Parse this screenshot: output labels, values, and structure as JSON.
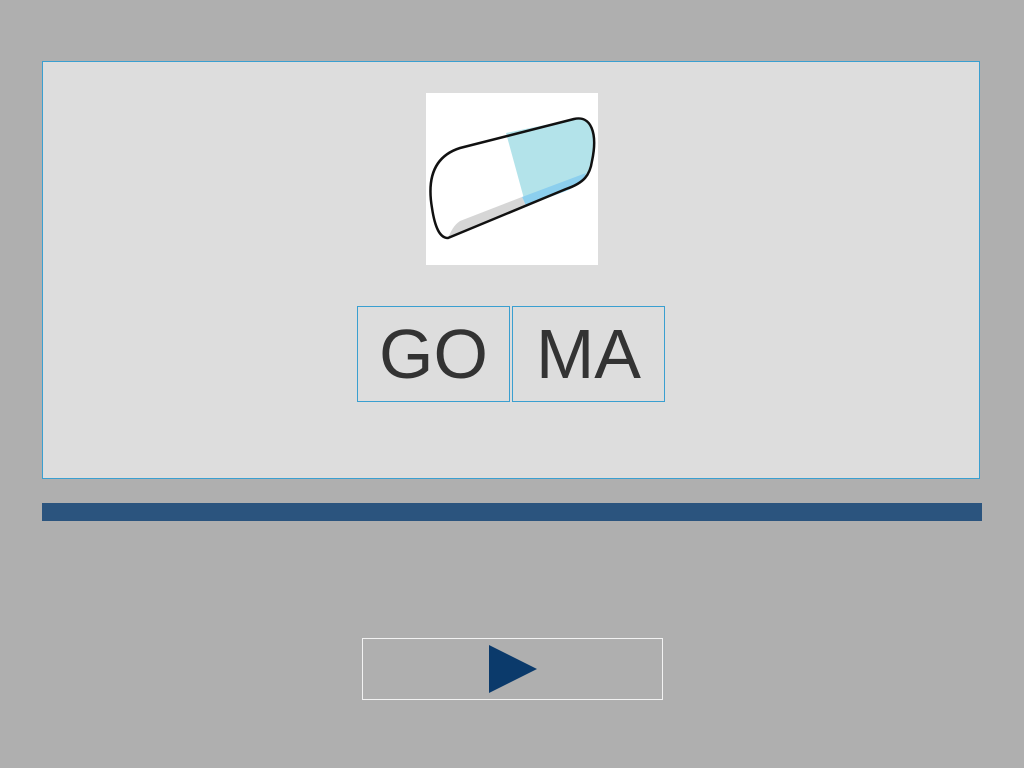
{
  "picture": {
    "icon": "eraser-icon"
  },
  "syllables": [
    {
      "text": "GO"
    },
    {
      "text": "MA"
    }
  ],
  "progress": {
    "fraction": 1.0
  },
  "next_button": {
    "icon": "play-triangle-icon"
  },
  "colors": {
    "background": "#afafaf",
    "card": "#dddddd",
    "border_accent": "#3a9fd0",
    "progress": "#2b547e",
    "play_icon": "#0b3a6b",
    "text": "#333333"
  }
}
